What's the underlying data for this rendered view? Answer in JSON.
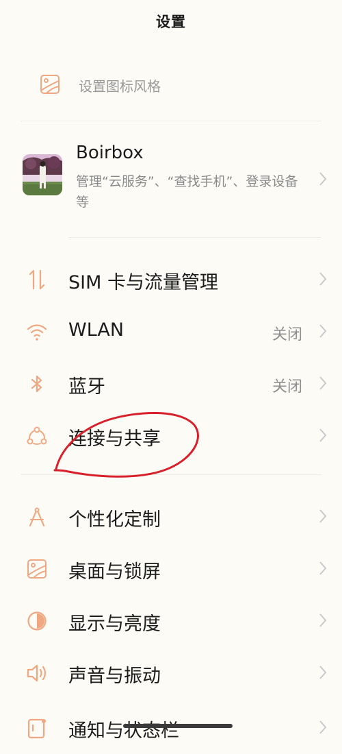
{
  "header": {
    "title": "设置"
  },
  "icon_style": {
    "label": "设置图标风格",
    "icon": "wallpaper-icon"
  },
  "account": {
    "name": "Boirbox",
    "description": "管理“云服务”、“查找手机”、登录设备等"
  },
  "items": [
    {
      "label": "SIM 卡与流量管理",
      "value": "",
      "icon": "data-transfer-icon"
    },
    {
      "label": "WLAN",
      "value": "关闭",
      "icon": "wifi-icon"
    },
    {
      "label": "蓝牙",
      "value": "关闭",
      "icon": "bluetooth-icon"
    },
    {
      "label": "连接与共享",
      "value": "",
      "icon": "connection-share-icon"
    },
    {
      "label": "个性化定制",
      "value": "",
      "icon": "compass-icon"
    },
    {
      "label": "桌面与锁屏",
      "value": "",
      "icon": "wallpaper-icon"
    },
    {
      "label": "显示与亮度",
      "value": "",
      "icon": "brightness-icon"
    },
    {
      "label": "声音与振动",
      "value": "",
      "icon": "speaker-icon"
    },
    {
      "label": "通知与状态栏",
      "value": "",
      "icon": "notification-icon"
    }
  ],
  "colors": {
    "accent": "#f0a882",
    "background": "#fcfbf6",
    "annotation": "#d8202a"
  }
}
